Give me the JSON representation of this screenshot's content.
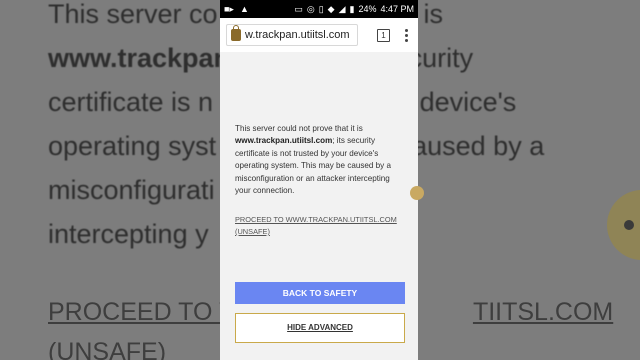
{
  "background": {
    "line1": "This server co",
    "line1b": "t it is",
    "line2_bold": "www.trackpan",
    "line2b": "security",
    "line3": "certificate is n",
    "line3b": "ur device's",
    "line4": "operating syst",
    "line4b": "e caused by a",
    "line5": "misconfigurati",
    "line6": "intercepting y",
    "link1": "PROCEED TO W",
    "link1b": "TIITSL.COM",
    "link2": "(UNSAFE)"
  },
  "statusbar": {
    "battery": "24%",
    "time": "4:47 PM"
  },
  "toolbar": {
    "url": "w.trackpan.utiitsl.com",
    "tab_count": "1"
  },
  "message": {
    "intro": "This server could not prove that it is",
    "domain": "www.trackpan.utiitsl.com",
    "rest": "; its security certificate is not trusted by your device's operating system. This may be caused by a misconfiguration or an attacker intercepting your connection."
  },
  "proceed_link": "PROCEED TO WWW.TRACKPAN.UTIITSL.COM (UNSAFE)",
  "buttons": {
    "back_to_safety": "BACK TO SAFETY",
    "hide_advanced": "HIDE ADVANCED"
  }
}
